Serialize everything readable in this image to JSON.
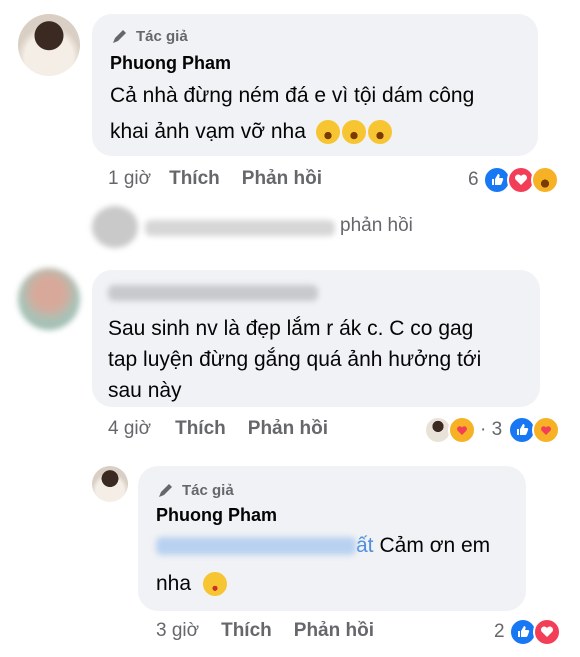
{
  "comment1": {
    "author_badge": "Tác giả",
    "author": "Phuong Pham",
    "text_line1": "Cả nhà đừng ném đá e vì tội dám công",
    "text_line2": "khai ảnh vạm vỡ nha",
    "time": "1 giờ",
    "like": "Thích",
    "reply": "Phản hồi",
    "reaction_count": "6",
    "reactions": [
      "like",
      "love",
      "haha"
    ]
  },
  "hidden_replies": {
    "text": "phản hồi"
  },
  "comment2": {
    "text_line1": "Sau sinh nv là đẹp lắm r ák c. C co gag",
    "text_line2": "tap luyện đừng gắng quá ảnh hưởng tới",
    "text_line3": "sau này",
    "time": "4 giờ",
    "like": "Thích",
    "reply": "Phản hồi",
    "dot_count": "· 3",
    "reactions": [
      "like",
      "care"
    ]
  },
  "comment3": {
    "author_badge": "Tác giả",
    "author": "Phuong Pham",
    "mention_suffix": "ất",
    "text_after_mention": "Cảm ơn em",
    "text_line2": "nha",
    "time": "3 giờ",
    "like": "Thích",
    "reply": "Phản hồi",
    "reaction_count": "2",
    "reactions": [
      "like",
      "love"
    ]
  },
  "colors": {
    "bubble": "#f0f2f5",
    "secondary_text": "#65676b",
    "like_blue": "#1877f2",
    "love_red": "#f33e58",
    "haha_yellow": "#f7b125",
    "mention_blue": "#4e8ede"
  }
}
